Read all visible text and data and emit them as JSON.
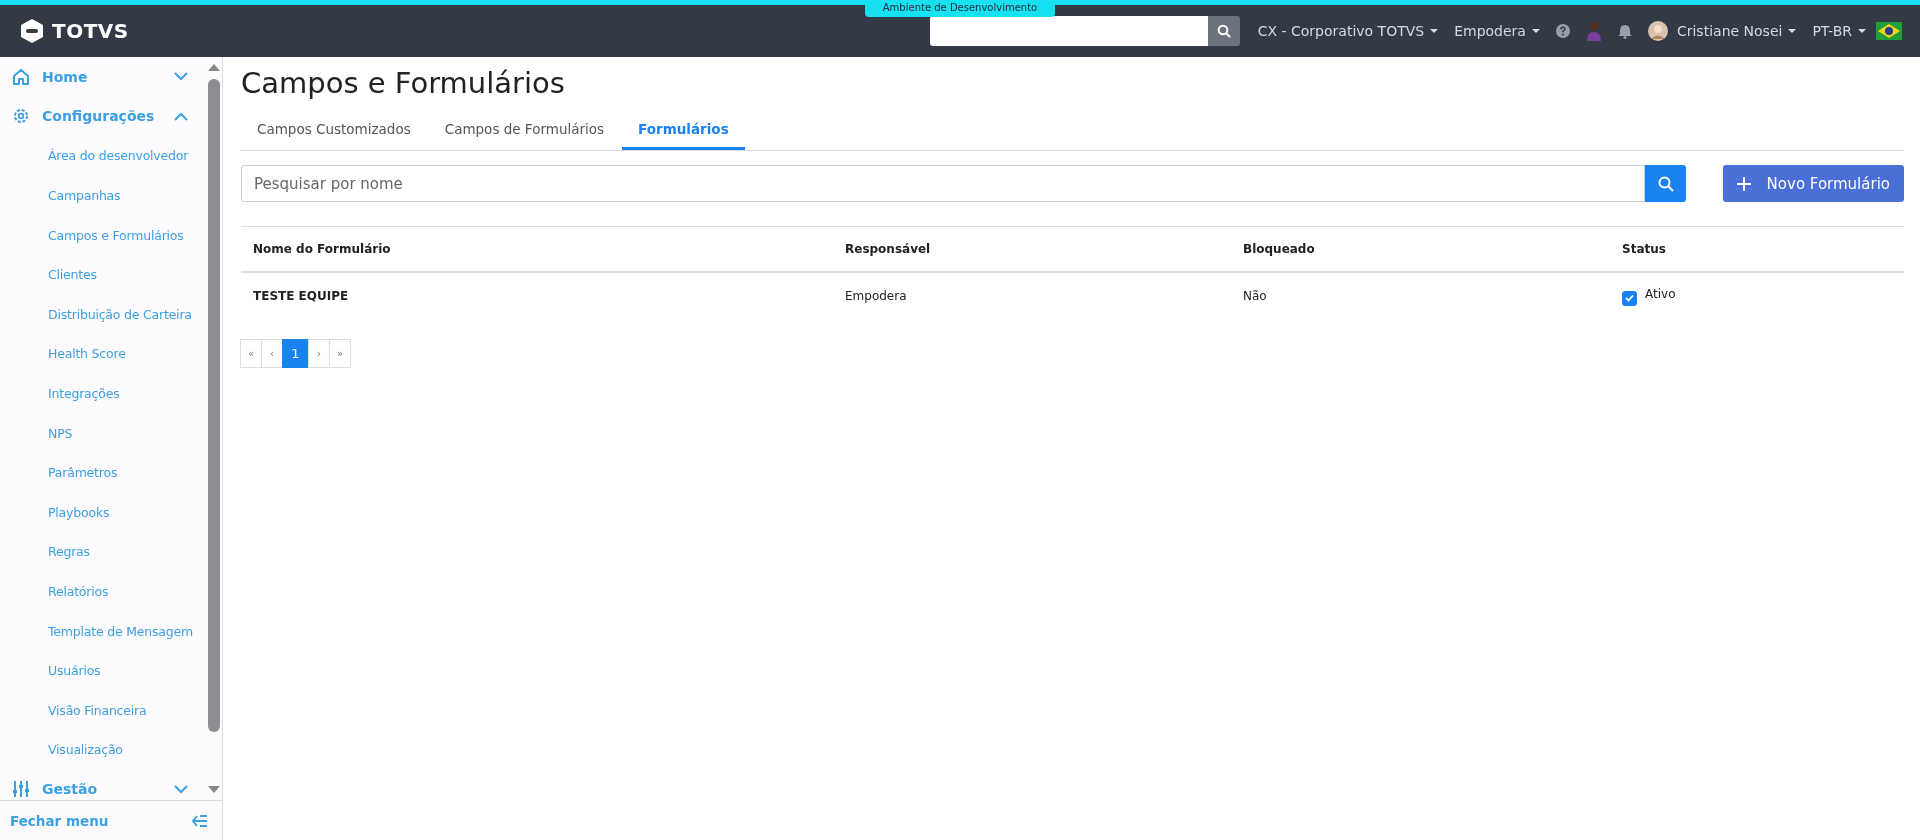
{
  "env_badge": "Ambiente de Desenvolvimento",
  "topbar": {
    "logo": "TOTVS",
    "menus": [
      {
        "label": "CX - Corporativo TOTVS"
      },
      {
        "label": "Empodera"
      }
    ],
    "user": "Cristiane Nosei",
    "language": "PT-BR"
  },
  "sidebar": {
    "items": [
      {
        "label": "Home",
        "kind": "home",
        "expanded": false
      },
      {
        "label": "Configurações",
        "kind": "settings",
        "expanded": true,
        "children": [
          {
            "label": "Área do desenvolvedor"
          },
          {
            "label": "Campanhas"
          },
          {
            "label": "Campos e Formulários"
          },
          {
            "label": "Clientes"
          },
          {
            "label": "Distribuição de Carteira"
          },
          {
            "label": "Health Score"
          },
          {
            "label": "Integrações"
          },
          {
            "label": "NPS"
          },
          {
            "label": "Parâmetros"
          },
          {
            "label": "Playbooks"
          },
          {
            "label": "Regras"
          },
          {
            "label": "Relatórios"
          },
          {
            "label": "Template de Mensagem"
          },
          {
            "label": "Usuários"
          },
          {
            "label": "Visão Financeira"
          },
          {
            "label": "Visualização"
          }
        ]
      },
      {
        "label": "Gestão",
        "kind": "sliders",
        "expanded": false
      }
    ],
    "footer": "Fechar menu"
  },
  "page": {
    "title": "Campos e Formulários",
    "tabs": [
      {
        "label": "Campos Customizados",
        "selected": false
      },
      {
        "label": "Campos de Formulários",
        "selected": false
      },
      {
        "label": "Formulários",
        "selected": true
      }
    ],
    "search": {
      "placeholder": "Pesquisar por nome"
    },
    "new_button": "Novo Formulário",
    "table": {
      "columns": [
        "Nome do Formulário",
        "Responsável",
        "Bloqueado",
        "Status"
      ],
      "rows": [
        {
          "name": "TESTE EQUIPE",
          "owner": "Empodera",
          "blocked": "Não",
          "status": {
            "label": "Ativo",
            "checked": true
          }
        }
      ]
    },
    "pagination": [
      {
        "label": "«",
        "selected": false
      },
      {
        "label": "‹",
        "selected": false
      },
      {
        "label": "1",
        "selected": true
      },
      {
        "label": "›",
        "selected": false
      },
      {
        "label": "»",
        "selected": false
      }
    ]
  }
}
